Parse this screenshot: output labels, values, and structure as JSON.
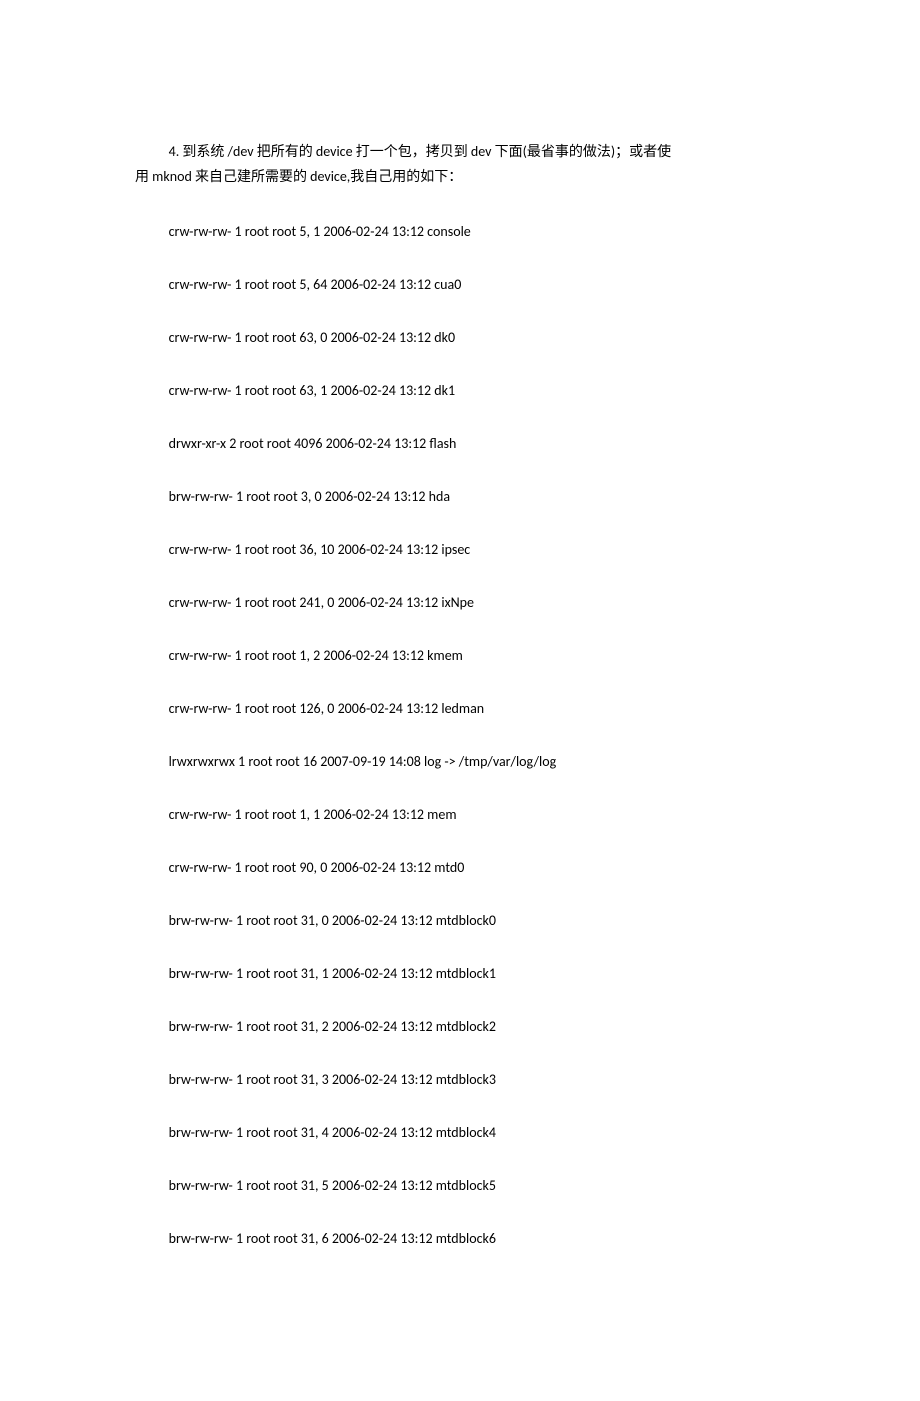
{
  "intro": {
    "line1": "4.  到系统 /dev 把所有的 device 打一个包，拷贝到 dev 下面(最省事的做法)；或者使",
    "line2": "用 mknod 来自己建所需要的 device,我自己用的如下："
  },
  "entries": [
    "crw-rw-rw- 1 root root 5, 1 2006-02-24 13:12 console",
    "crw-rw-rw- 1 root root 5, 64 2006-02-24 13:12 cua0",
    "crw-rw-rw- 1 root root 63, 0 2006-02-24 13:12 dk0",
    "crw-rw-rw- 1 root root 63, 1 2006-02-24 13:12 dk1",
    "drwxr-xr-x 2 root root 4096 2006-02-24 13:12 flash",
    "brw-rw-rw- 1 root root 3, 0 2006-02-24 13:12 hda",
    "crw-rw-rw- 1 root root 36, 10 2006-02-24 13:12 ipsec",
    "crw-rw-rw- 1 root root 241, 0 2006-02-24 13:12 ixNpe",
    "crw-rw-rw- 1 root root 1, 2 2006-02-24 13:12 kmem",
    "crw-rw-rw- 1 root root 126, 0 2006-02-24 13:12 ledman",
    "lrwxrwxrwx 1 root root 16 2007-09-19 14:08 log -> /tmp/var/log/log",
    "crw-rw-rw- 1 root root 1, 1 2006-02-24 13:12 mem",
    "crw-rw-rw- 1 root root 90, 0 2006-02-24 13:12 mtd0",
    "brw-rw-rw- 1 root root 31, 0 2006-02-24 13:12 mtdblock0",
    "brw-rw-rw- 1 root root 31, 1 2006-02-24 13:12 mtdblock1",
    "brw-rw-rw- 1 root root 31, 2 2006-02-24 13:12 mtdblock2",
    "brw-rw-rw- 1 root root 31, 3 2006-02-24 13:12 mtdblock3",
    "brw-rw-rw- 1 root root 31, 4 2006-02-24 13:12 mtdblock4",
    "brw-rw-rw- 1 root root 31, 5 2006-02-24 13:12 mtdblock5",
    "brw-rw-rw- 1 root root 31, 6 2006-02-24 13:12 mtdblock6"
  ]
}
